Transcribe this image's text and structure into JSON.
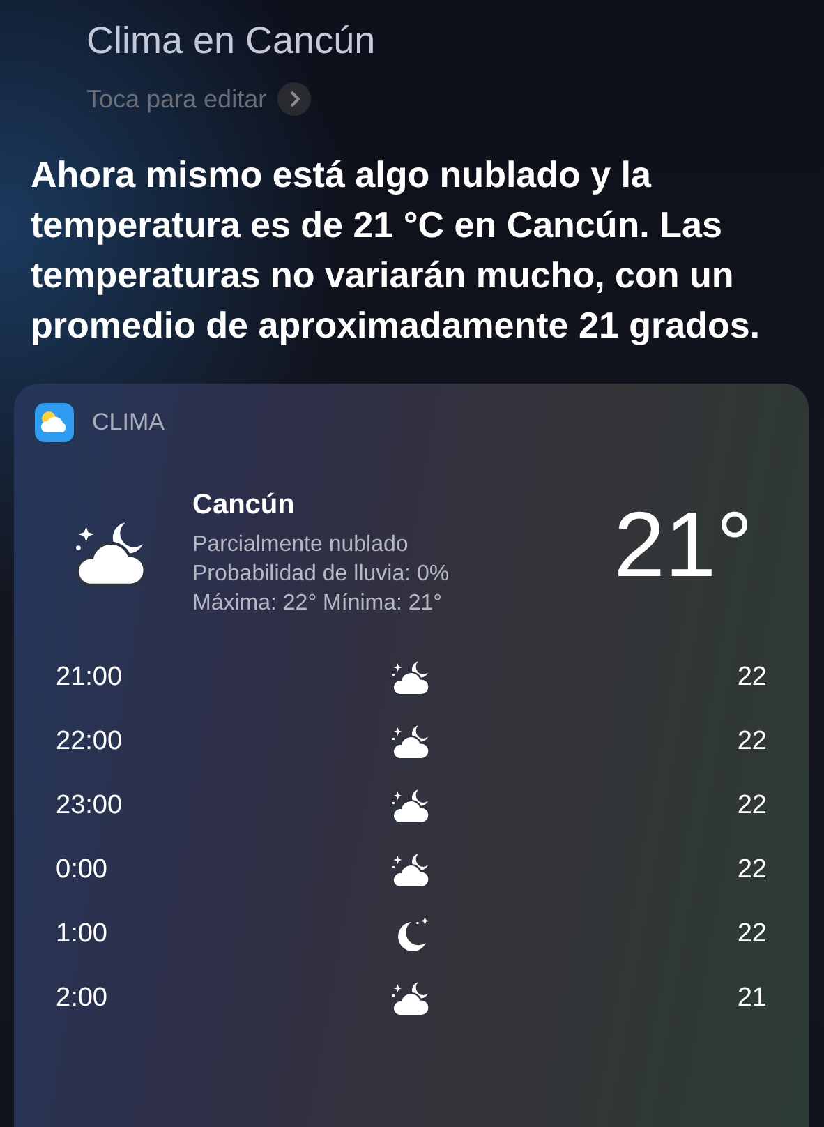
{
  "query": {
    "text": "Clima en Cancún",
    "hint": "Toca para editar"
  },
  "answer": "Ahora mismo está algo nublado y la temperatura es de 21 °C en Cancún. Las temperaturas no variarán mucho, con un promedio de aproximadamente 21 grados.",
  "card": {
    "app_name": "CLIMA",
    "city": "Cancún",
    "condition": "Parcialmente nublado",
    "rain": "Probabilidad de lluvia: 0%",
    "high_low": "Máxima: 22° Mínima: 21°",
    "temperature": "21°",
    "current": {
      "kind": "partly_cloudy_night"
    },
    "hours": [
      {
        "time": "21:00",
        "kind": "partly_cloudy_night",
        "temp": "22"
      },
      {
        "time": "22:00",
        "kind": "partly_cloudy_night",
        "temp": "22"
      },
      {
        "time": "23:00",
        "kind": "partly_cloudy_night",
        "temp": "22"
      },
      {
        "time": "0:00",
        "kind": "partly_cloudy_night",
        "temp": "22"
      },
      {
        "time": "1:00",
        "kind": "clear_night",
        "temp": "22"
      },
      {
        "time": "2:00",
        "kind": "partly_cloudy_night",
        "temp": "21"
      }
    ]
  }
}
